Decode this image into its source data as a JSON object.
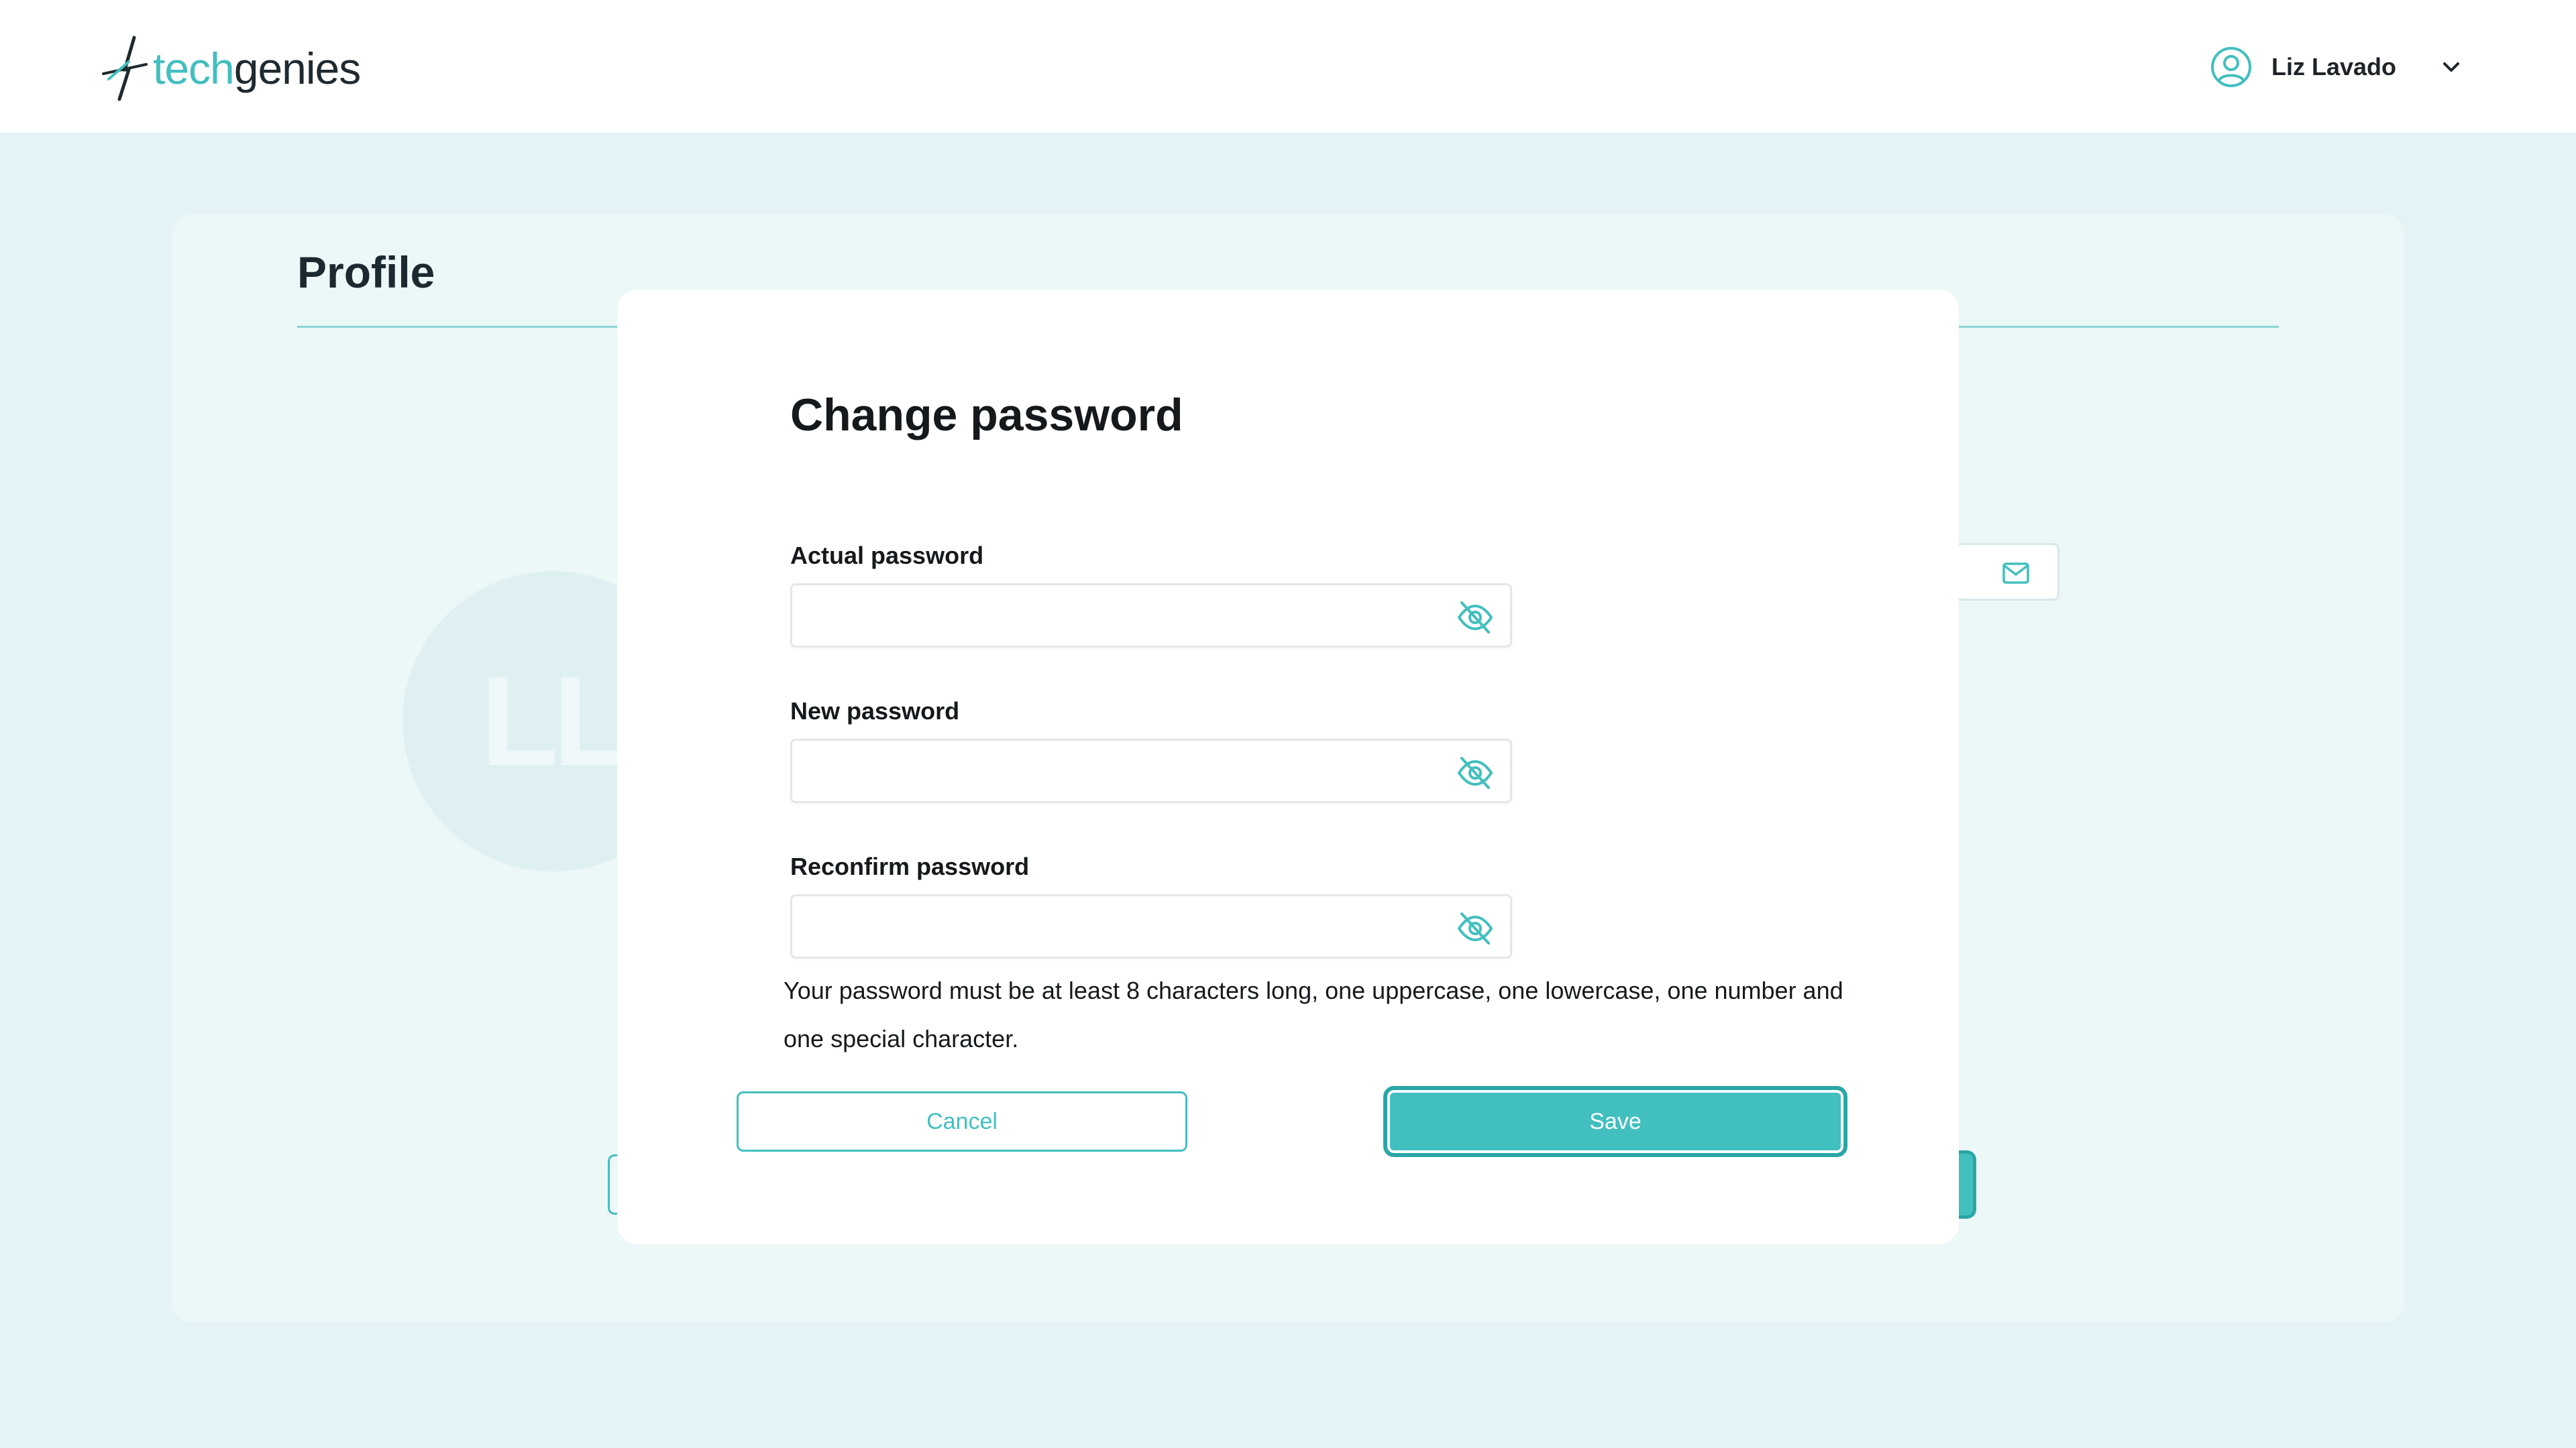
{
  "header": {
    "logo_tech": "tech",
    "logo_genies": "genies",
    "user_name": "Liz Lavado"
  },
  "page": {
    "title": "Profile",
    "avatar_initials": "LL"
  },
  "modal": {
    "title": "Change password",
    "fields": [
      {
        "label": "Actual password",
        "value": "",
        "icon": "eye-off-icon"
      },
      {
        "label": "New password",
        "value": "",
        "icon": "eye-off-icon"
      },
      {
        "label": "Reconfirm password",
        "value": "",
        "icon": "eye-off-icon"
      }
    ],
    "hint": "Your password must be at least 8 characters long, one uppercase, one lowercase, one number and one special character.",
    "cancel_label": "Cancel",
    "save_label": "Save"
  },
  "colors": {
    "accent": "#42bfbf",
    "accent_dark": "#2aa6a6",
    "page_bg": "#e3f3f6",
    "card_bg": "#ecf7f7"
  }
}
